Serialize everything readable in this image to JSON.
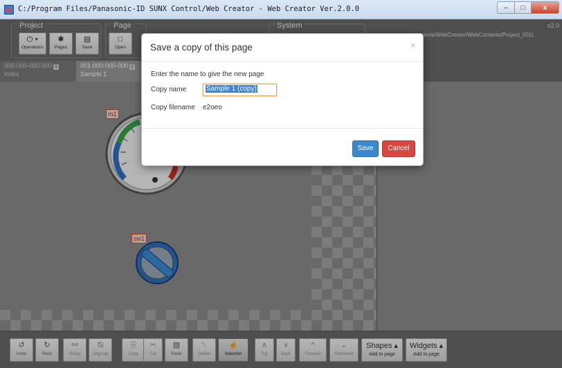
{
  "window": {
    "title": "C:/Program Files/Panasonic-ID SUNX Control/Web Creator - Web Creator Ver.2.0.0",
    "minimize": "–",
    "maximize": "□",
    "close": "x"
  },
  "ribbon": {
    "groups": {
      "project": "Project",
      "page": "Page",
      "system": "System"
    },
    "buttons": {
      "operations": {
        "icon": "⏻ ▾",
        "label": "Operations"
      },
      "pages": {
        "icon": "✱",
        "label": "Pages"
      },
      "save": {
        "icon": "▤",
        "label": "Save"
      },
      "open": {
        "icon": "□",
        "label": "Open"
      }
    },
    "version": "v2.0",
    "project_path": "nents/WebCreator/WebContents/Project_001)"
  },
  "tabs": [
    {
      "id": "000-000-000-000",
      "name": "index"
    },
    {
      "id": "001-000-000-000",
      "name": "Sample 1"
    }
  ],
  "canvas": {
    "gauge_tag": "m1",
    "switch_tag": "sw1"
  },
  "bottom_toolbar": {
    "undo": {
      "icon": "↺",
      "label": "Undo"
    },
    "redo": {
      "icon": "↻",
      "label": "Redo"
    },
    "group": {
      "icon": "⚯",
      "label": "Group"
    },
    "ungroup": {
      "icon": "⦰",
      "label": "Ungroup"
    },
    "copy": {
      "icon": "⎘",
      "label": "Copy"
    },
    "cut": {
      "icon": "✂",
      "label": "Cut"
    },
    "paste": {
      "icon": "▧",
      "label": "Paste"
    },
    "delete": {
      "icon": "␡",
      "label": "Delete"
    },
    "selection": {
      "icon": "☝",
      "label": "Selection"
    },
    "top": {
      "icon": "∧",
      "label": "Top"
    },
    "back": {
      "icon": "∨",
      "label": "Back"
    },
    "forward": {
      "icon": "^",
      "label": "Forward"
    },
    "backward": {
      "icon": "⌄",
      "label": "Backward"
    },
    "shapes": {
      "title": "Shapes ▴",
      "label": "Add to page"
    },
    "widgets": {
      "title": "Widgets ▴",
      "label": "Add to page"
    }
  },
  "modal": {
    "title": "Save a copy of this page",
    "close": "×",
    "prompt": "Enter the name to give the new page",
    "copy_name_label": "Copy name",
    "copy_name_value": "Sample 1 (copy)",
    "copy_filename_label": "Copy filename",
    "copy_filename_value": "e2oeo",
    "save_button": "Save",
    "cancel_button": "Cancel"
  },
  "colors": {
    "save_button": "#3a89cf",
    "cancel_button": "#d9463f",
    "input_focus": "#f0a44c",
    "text_selection": "#3c84d6"
  }
}
